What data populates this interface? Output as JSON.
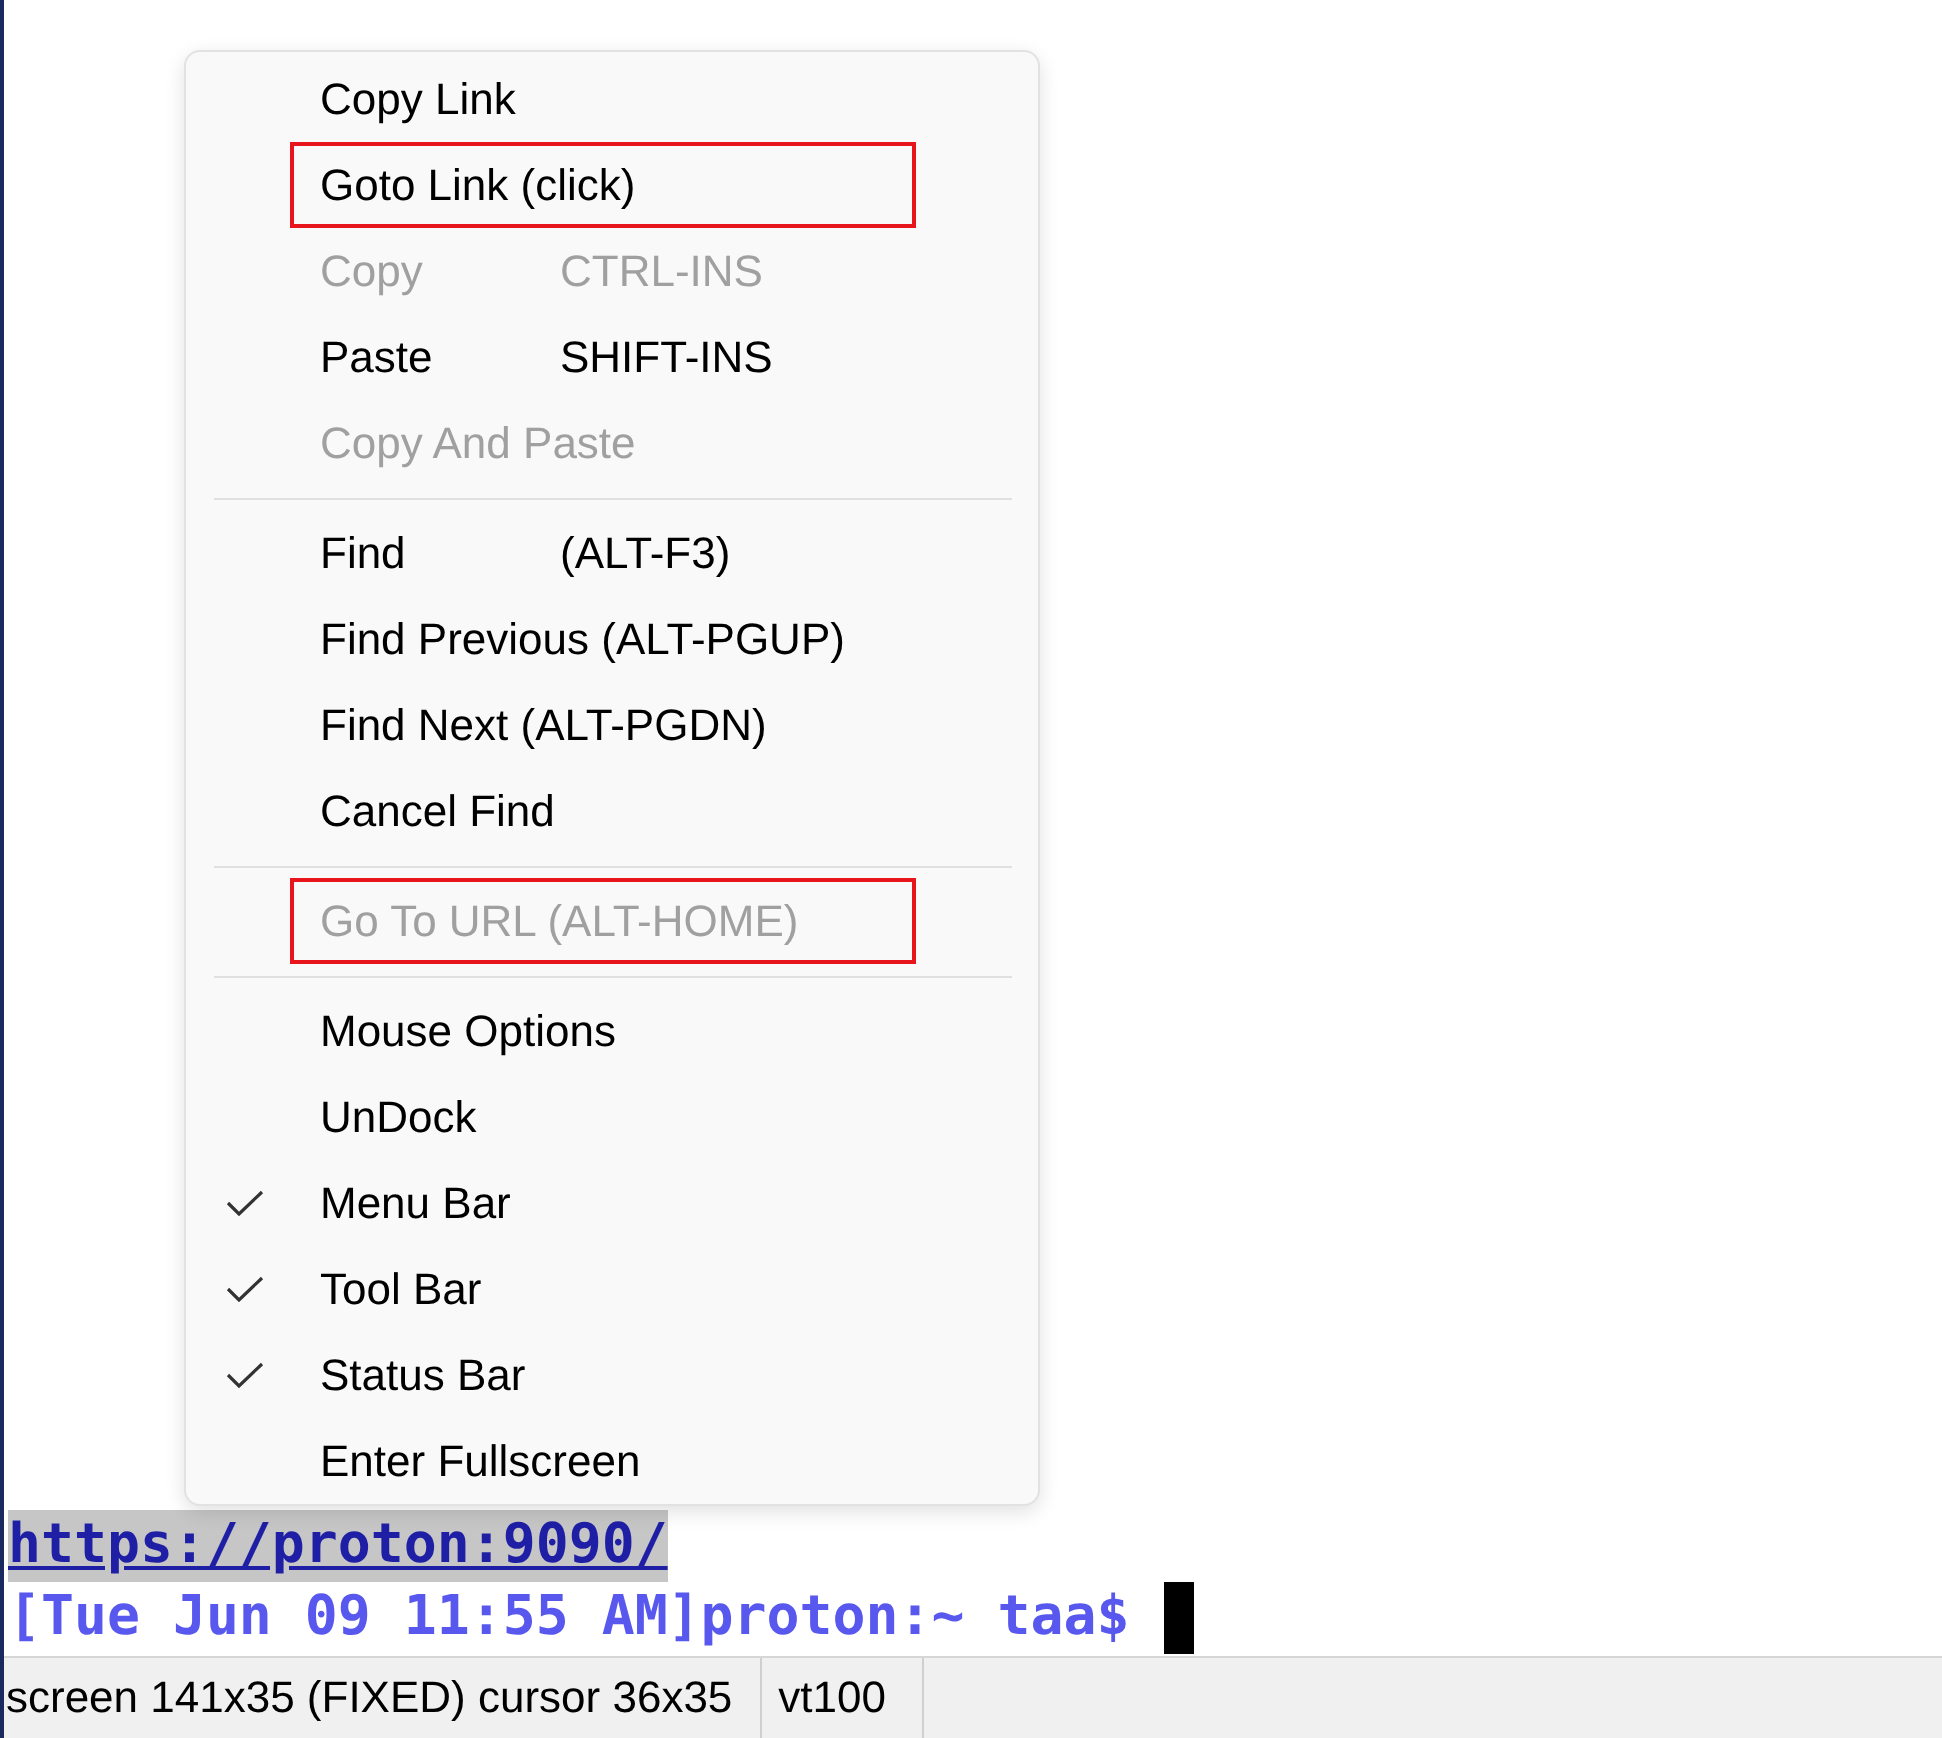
{
  "terminal": {
    "lines": [
      {
        "kind": "link",
        "text": "https://proton:9090/",
        "selected": true
      },
      {
        "kind": "prompt",
        "text": "[Tue Jun 09 11:55 AM]proton:~ taa$",
        "selected": false
      }
    ]
  },
  "status_bar": {
    "fields": [
      "screen 141x35 (FIXED) cursor 36x35",
      "vt100"
    ]
  },
  "context_menu": {
    "sections": [
      {
        "items": [
          {
            "label": "Copy Link",
            "disabled": false,
            "checked": false,
            "highlighted": false
          },
          {
            "label": "Goto Link (click)",
            "disabled": false,
            "checked": false,
            "highlighted": true
          },
          {
            "label": "Copy",
            "shortcut": "CTRL-INS",
            "disabled": true,
            "checked": false,
            "highlighted": false
          },
          {
            "label": "Paste",
            "shortcut": "SHIFT-INS",
            "disabled": false,
            "checked": false,
            "highlighted": false
          },
          {
            "label": "Copy And Paste",
            "disabled": true,
            "checked": false,
            "highlighted": false
          }
        ]
      },
      {
        "items": [
          {
            "label": "Find",
            "shortcut": "(ALT-F3)",
            "disabled": false,
            "checked": false,
            "highlighted": false
          },
          {
            "label": "Find Previous (ALT-PGUP)",
            "disabled": false,
            "checked": false,
            "highlighted": false
          },
          {
            "label": "Find Next (ALT-PGDN)",
            "disabled": false,
            "checked": false,
            "highlighted": false
          },
          {
            "label": "Cancel Find",
            "disabled": false,
            "checked": false,
            "highlighted": false
          }
        ]
      },
      {
        "items": [
          {
            "label": "Go To URL (ALT-HOME)",
            "disabled": true,
            "checked": false,
            "highlighted": true
          }
        ]
      },
      {
        "items": [
          {
            "label": "Mouse Options",
            "disabled": false,
            "checked": false,
            "highlighted": false
          },
          {
            "label": "UnDock",
            "disabled": false,
            "checked": false,
            "highlighted": false
          },
          {
            "label": "Menu Bar",
            "disabled": false,
            "checked": true,
            "highlighted": false
          },
          {
            "label": "Tool Bar",
            "disabled": false,
            "checked": true,
            "highlighted": false
          },
          {
            "label": "Status Bar",
            "disabled": false,
            "checked": true,
            "highlighted": false
          },
          {
            "label": "Enter Fullscreen",
            "disabled": false,
            "checked": false,
            "highlighted": false
          }
        ]
      }
    ]
  }
}
